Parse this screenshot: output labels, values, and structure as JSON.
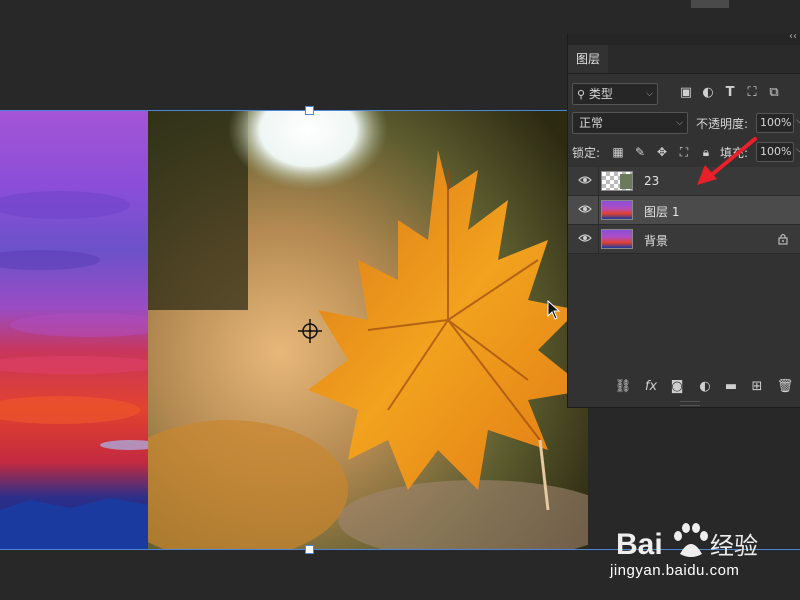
{
  "panel": {
    "tab_label": "图层",
    "kind_filter": {
      "label": "类型",
      "icon": "search-icon"
    },
    "filter_icons": [
      "image-filter-icon",
      "adjustment-filter-icon",
      "type-filter-icon",
      "shape-filter-icon",
      "smart-object-filter-icon"
    ],
    "blend_mode": "正常",
    "opacity_label": "不透明度:",
    "opacity_value": "100%",
    "lock_label": "锁定:",
    "lock_icons": [
      "lock-transparent-icon",
      "lock-paint-icon",
      "lock-position-icon",
      "lock-artboard-icon",
      "lock-all-icon"
    ],
    "fill_label": "填充:",
    "fill_value": "100%",
    "layers": [
      {
        "name": "23",
        "visible": true,
        "selected": false,
        "locked": false,
        "thumb": "transparent-leaf"
      },
      {
        "name": "图层 1",
        "visible": true,
        "selected": true,
        "locked": false,
        "thumb": "sunset"
      },
      {
        "name": "背景",
        "visible": true,
        "selected": false,
        "locked": true,
        "thumb": "sunset"
      }
    ],
    "bottom_icons": [
      "link-layers-icon",
      "fx-icon",
      "add-mask-icon",
      "adjustment-layer-icon",
      "folder-icon",
      "new-layer-icon",
      "trash-icon"
    ]
  },
  "accent_color": "#4c86d8",
  "annotation_arrow_color": "#e8202a",
  "watermark": {
    "brand": "Bai du 经验",
    "url": "jingyan.baidu.com"
  }
}
